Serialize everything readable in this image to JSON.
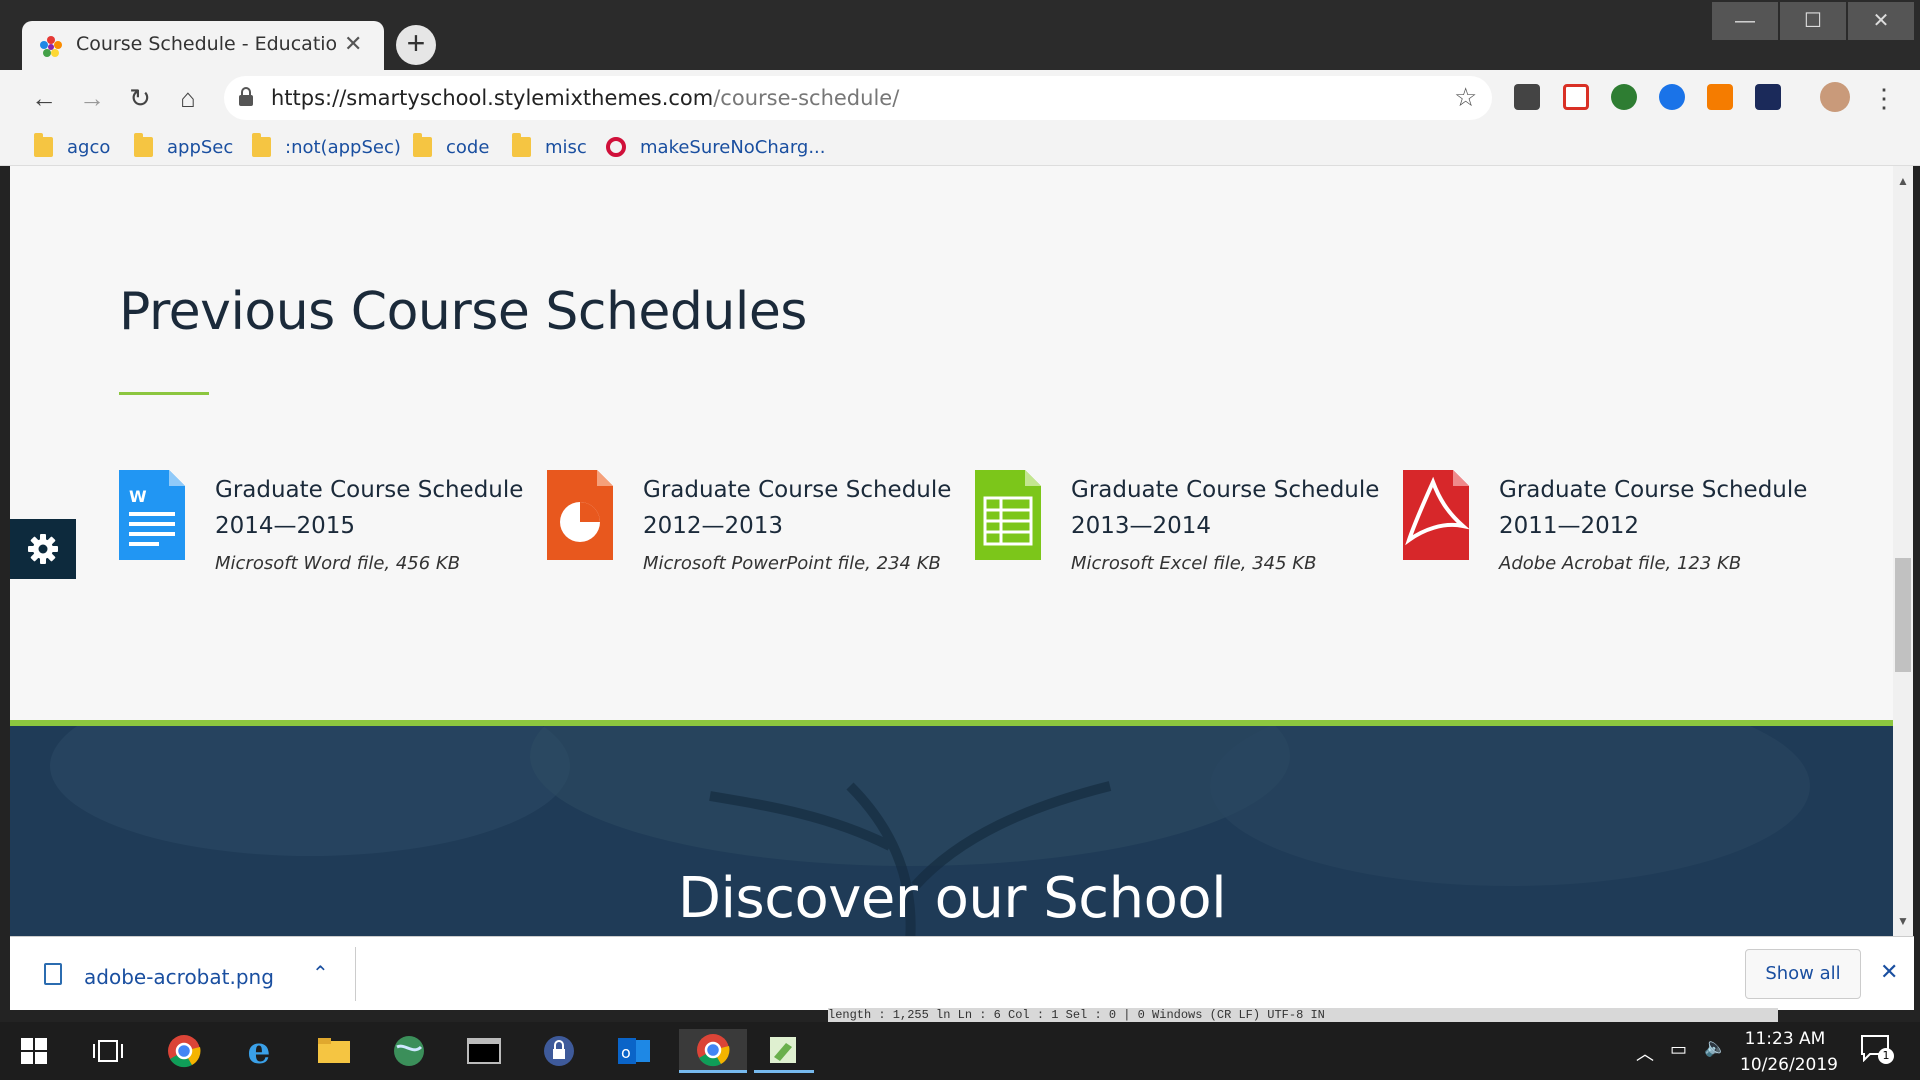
{
  "browser": {
    "tab_title": "Course Schedule - Education Wo",
    "url_host": "https://smartyschool.stylemixthemes.com",
    "url_path": "/course-schedule/",
    "bookmarks": [
      "agco",
      "appSec",
      ":not(appSec)",
      "code",
      "misc",
      "makeSureNoCharg..."
    ]
  },
  "page": {
    "section_title": "Previous Course Schedules",
    "documents": [
      {
        "title": "Graduate Course Schedule 2014—2015",
        "meta": "Microsoft Word file, 456 KB",
        "icon": "word-file-icon",
        "color": "#2196f3"
      },
      {
        "title": "Graduate Course Schedule 2012—2013",
        "meta": "Microsoft PowerPoint file, 234 KB",
        "icon": "powerpoint-file-icon",
        "color": "#e8581e"
      },
      {
        "title": "Graduate Course Schedule 2013—2014",
        "meta": "Microsoft Excel file, 345 KB",
        "icon": "excel-file-icon",
        "color": "#7cc61a"
      },
      {
        "title": "Graduate Course Schedule 2011—2012",
        "meta": "Adobe Acrobat file, 123 KB",
        "icon": "pdf-file-icon",
        "color": "#d7272a"
      }
    ],
    "banner_title": "Discover our School",
    "accent_color": "#8cc63f"
  },
  "downloads": {
    "file_name": "adobe-acrobat.png",
    "show_all": "Show all"
  },
  "editor_strip": "length : 1,255    ln Ln : 6    Col : 1    Sel : 0 | 0                         Windows (CR LF)        UTF-8                                    IN",
  "taskbar": {
    "time": "11:23 AM",
    "date": "10/26/2019",
    "notification_count": "1"
  }
}
